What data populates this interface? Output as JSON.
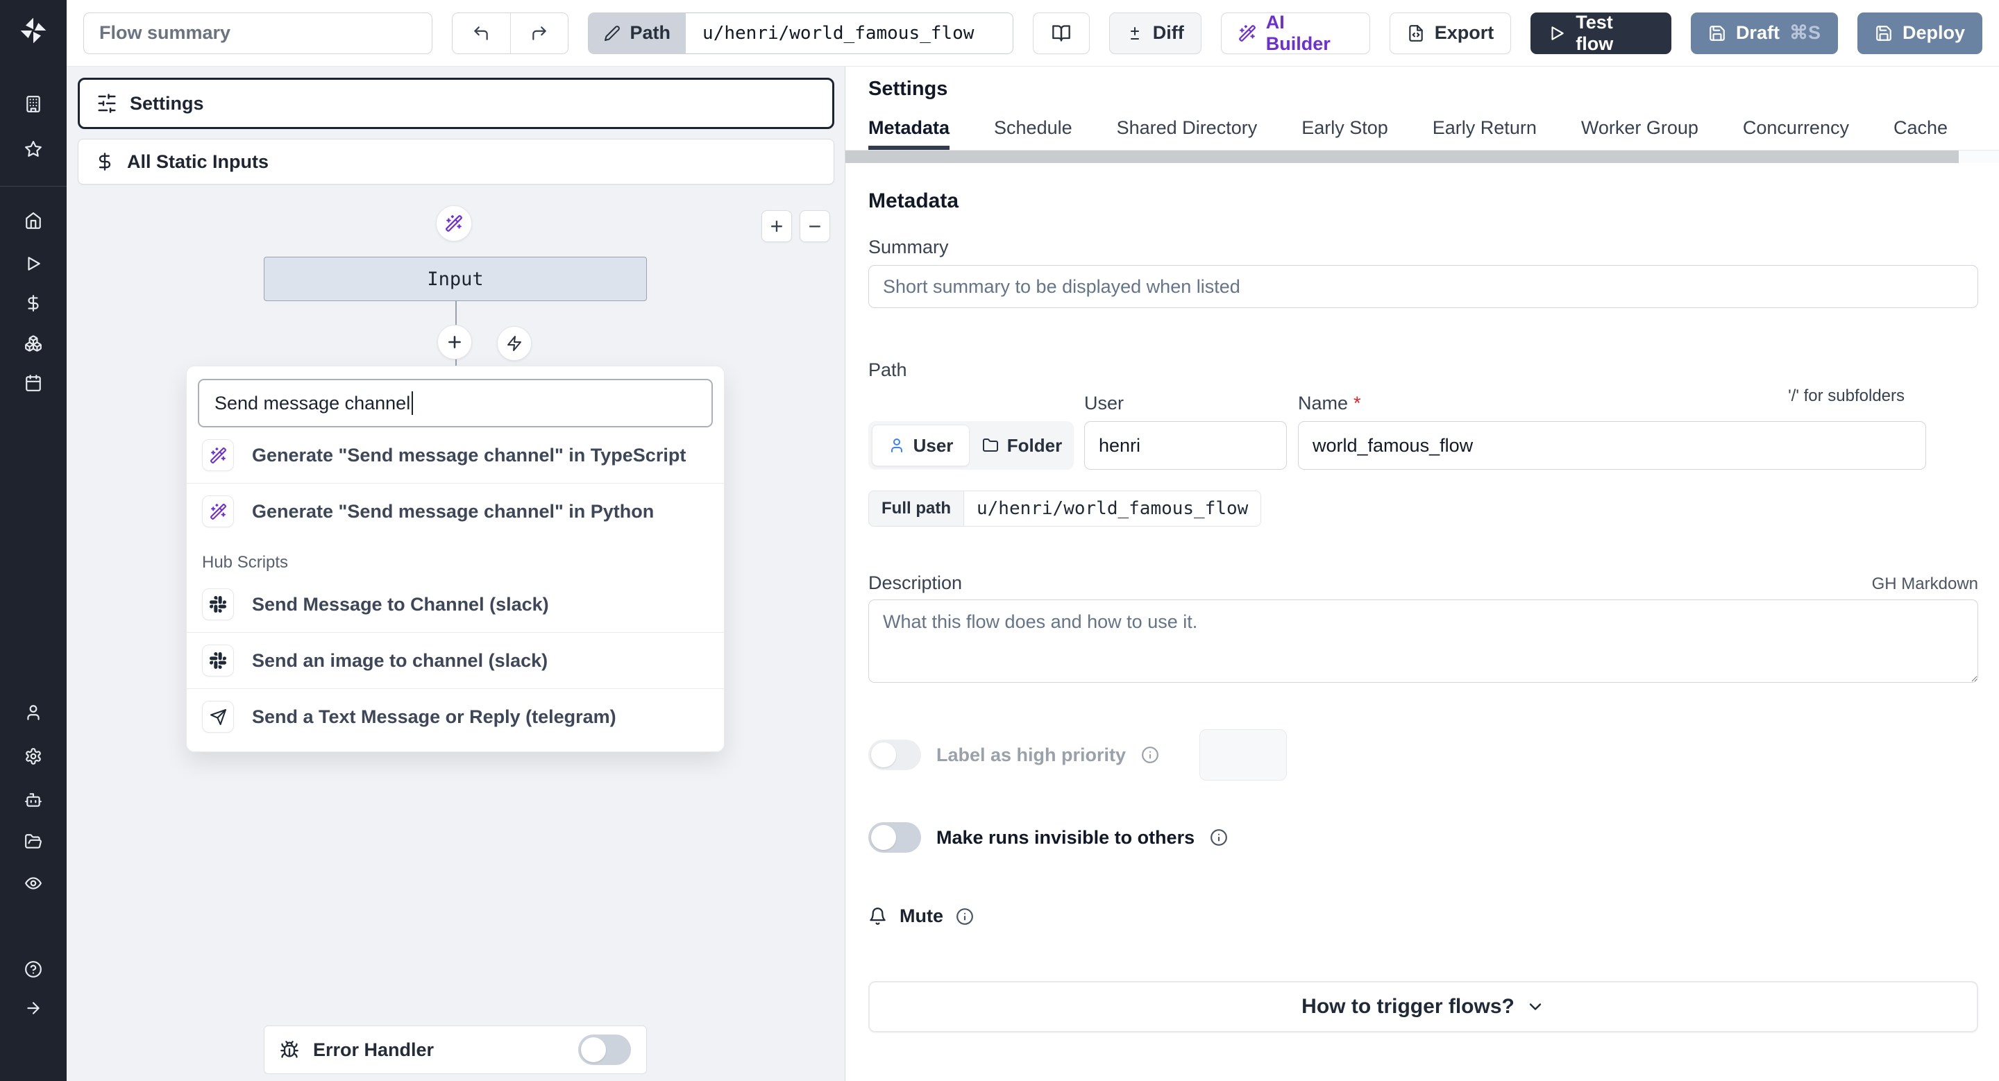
{
  "colors": {
    "accent_purple": "#6d2fd4",
    "action_slate": "#6a83a2",
    "dark_navy": "#2a3140",
    "sidebar_bg": "#1e232e",
    "canvas_bg": "#f1f2f5"
  },
  "topbar": {
    "summary_placeholder": "Flow summary",
    "path_chip": "Path",
    "path_value": "u/henri/world_famous_flow",
    "diff": "Diff",
    "ai_builder": "AI Builder",
    "export": "Export",
    "test_flow": "Test flow",
    "draft": "Draft",
    "draft_shortcut": "⌘S",
    "deploy": "Deploy"
  },
  "canvas": {
    "settings_node": "Settings",
    "static_inputs_node": "All Static Inputs",
    "input_node": "Input",
    "zoom_in": "+",
    "zoom_out": "−",
    "search_value": "Send message channel",
    "suggestions": [
      {
        "icon": "wand-sparkles-icon",
        "label": "Generate \"Send message channel\" in TypeScript"
      },
      {
        "icon": "wand-sparkles-icon",
        "label": "Generate \"Send message channel\" in Python"
      }
    ],
    "hub_section": "Hub Scripts",
    "hub_items": [
      {
        "icon": "slack-icon",
        "label": "Send Message to Channel (slack)"
      },
      {
        "icon": "slack-icon",
        "label": "Send an image to channel (slack)"
      },
      {
        "icon": "telegram-send-icon",
        "label": "Send a Text Message or Reply (telegram)"
      }
    ],
    "error_handler": "Error Handler",
    "error_handler_enabled": false
  },
  "panel": {
    "title": "Settings",
    "tabs": [
      "Metadata",
      "Schedule",
      "Shared Directory",
      "Early Stop",
      "Early Return",
      "Worker Group",
      "Concurrency",
      "Cache"
    ],
    "active_tab": "Metadata",
    "metadata": {
      "heading": "Metadata",
      "summary_label": "Summary",
      "summary_placeholder": "Short summary to be displayed when listed",
      "path_section_label": "Path",
      "owner_user": "User",
      "owner_folder": "Folder",
      "user_field_label": "User",
      "user_value": "henri",
      "name_field_label": "Name",
      "required_mark": "*",
      "name_value": "world_famous_flow",
      "subfolders_hint": "'/' for subfolders",
      "full_path_label": "Full path",
      "full_path_value": "u/henri/world_famous_flow",
      "description_label": "Description",
      "markdown_hint": "GH Markdown",
      "description_placeholder": "What this flow does and how to use it.",
      "priority_label": "Label as high priority",
      "priority_enabled": false,
      "invisible_label": "Make runs invisible to others",
      "invisible_enabled": false,
      "mute_label": "Mute",
      "trigger_cta": "How to trigger flows?"
    }
  }
}
